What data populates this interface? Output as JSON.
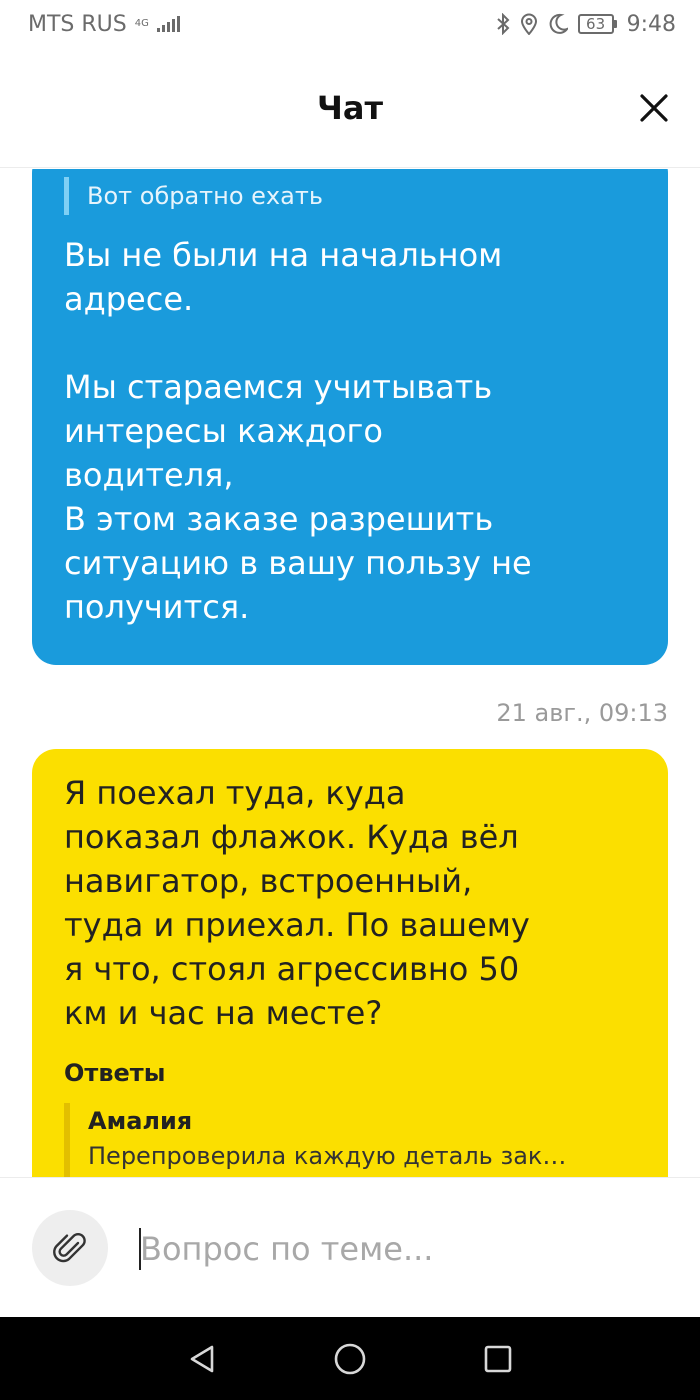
{
  "status_bar": {
    "carrier": "MTS RUS",
    "network": "4G",
    "battery": "63",
    "time": "9:48"
  },
  "header": {
    "title": "Чат"
  },
  "messages": [
    {
      "quote": "Вот обратно ехать",
      "text": "Вы не были на начальном\nадресе.\n\nМы стараемся учитывать\nинтересы каждого\nводителя,\nВ этом заказе разрешить\nситуацию в вашу пользу не\nполучится.",
      "color": "#1a9bdc"
    },
    {
      "timestamp": "21 авг., 09:13",
      "text": "Я поехал туда, куда\nпоказал флажок. Куда вёл\nнавигатор, встроенный,\nтуда и приехал. По вашему\nя что, стоял агрессивно 50\nкм и час на месте?",
      "answers_title": "Ответы",
      "reply_author": "Амалия",
      "reply_text": "Перепроверила каждую деталь зак…",
      "color": "#fbdf00"
    }
  ],
  "input": {
    "placeholder": "Вопрос по теме..."
  },
  "icons": [
    "bluetooth-icon",
    "location-icon",
    "moon-icon",
    "close-icon",
    "paperclip-icon",
    "back-icon",
    "home-icon",
    "recents-icon"
  ]
}
